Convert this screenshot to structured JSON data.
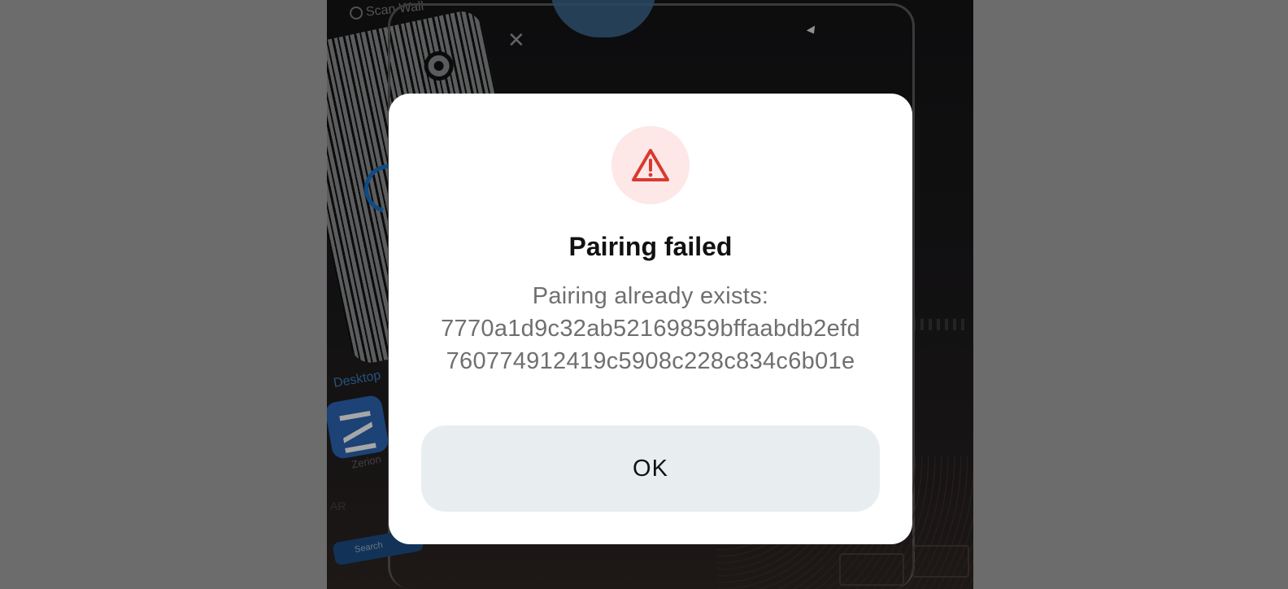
{
  "background": {
    "scan_hint": "Scan Wall",
    "desktop_label": "Desktop",
    "app_name": "Zerion",
    "ar_text": "AR",
    "search_label": "Search"
  },
  "dialog": {
    "icon": "warning-triangle-icon",
    "title": "Pairing failed",
    "message_line1": "Pairing already exists:",
    "message_line2": "7770a1d9c32ab52169859bffaabdb2efd",
    "message_line3": "760774912419c5908c228c834c6b01e",
    "ok_label": "OK"
  },
  "colors": {
    "danger": "#d93a2f",
    "danger_bg": "#fde7e7",
    "button_bg": "#e8eef0"
  }
}
